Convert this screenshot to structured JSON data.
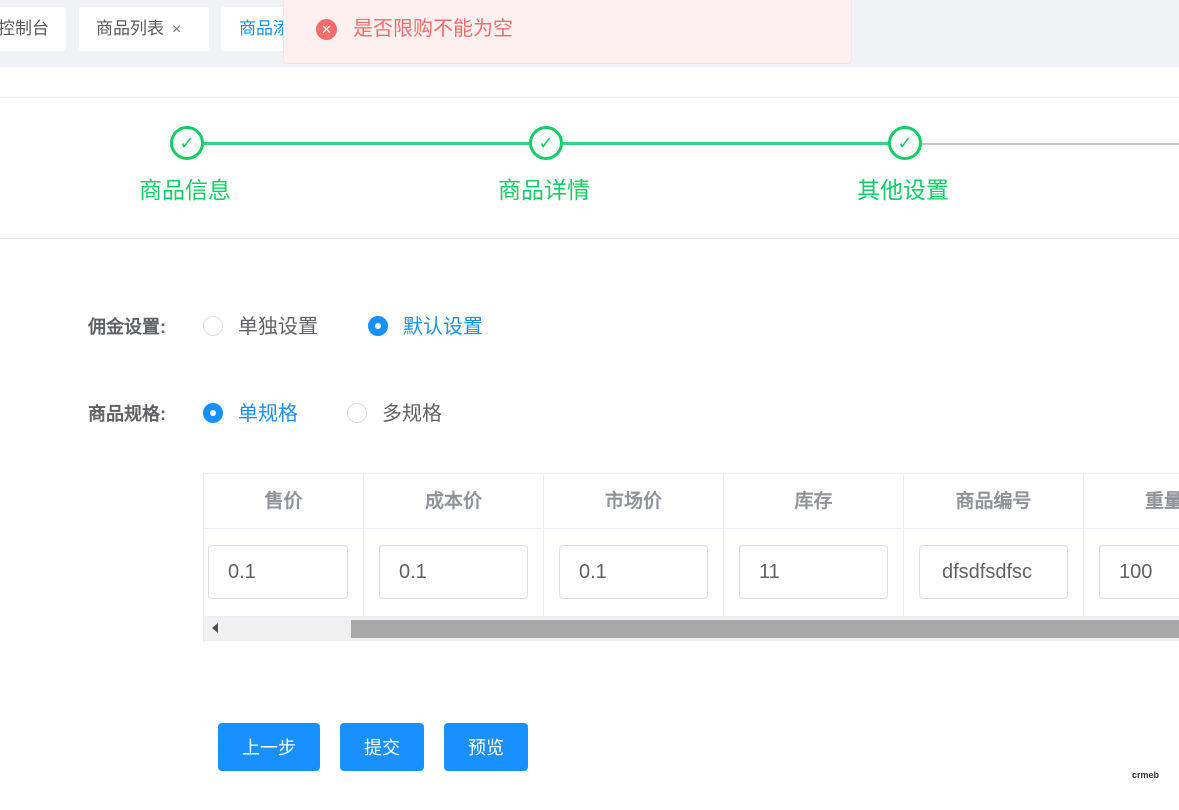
{
  "tabs": [
    {
      "label": "控制台"
    },
    {
      "label": "商品列表",
      "close": "×"
    },
    {
      "label": "商品添加"
    }
  ],
  "toast": {
    "icon": "error-circle-icon",
    "message": "是否限购不能为空",
    "color": "#f56c6c"
  },
  "steps": [
    {
      "title": "商品信息",
      "status": "done"
    },
    {
      "title": "商品详情",
      "status": "done"
    },
    {
      "title": "其他设置",
      "status": "done"
    }
  ],
  "form": {
    "commission": {
      "label": "佣金设置:",
      "options": [
        {
          "label": "单独设置",
          "checked": false
        },
        {
          "label": "默认设置",
          "checked": true
        }
      ]
    },
    "spec": {
      "label": "商品规格:",
      "options": [
        {
          "label": "单规格",
          "checked": true
        },
        {
          "label": "多规格",
          "checked": false
        }
      ]
    }
  },
  "table": {
    "columns": [
      "售价",
      "成本价",
      "市场价",
      "库存",
      "商品编号",
      "重量（"
    ],
    "row": [
      "0.1",
      "0.1",
      "0.1",
      "11",
      "dfsdfsdfsc",
      "100"
    ]
  },
  "buttons": {
    "prev": "上一步",
    "submit": "提交",
    "preview": "预览"
  },
  "colors": {
    "primary": "#1890ff",
    "success": "#13ce66",
    "error": "#f56c6c"
  },
  "watermark": "crmeb"
}
